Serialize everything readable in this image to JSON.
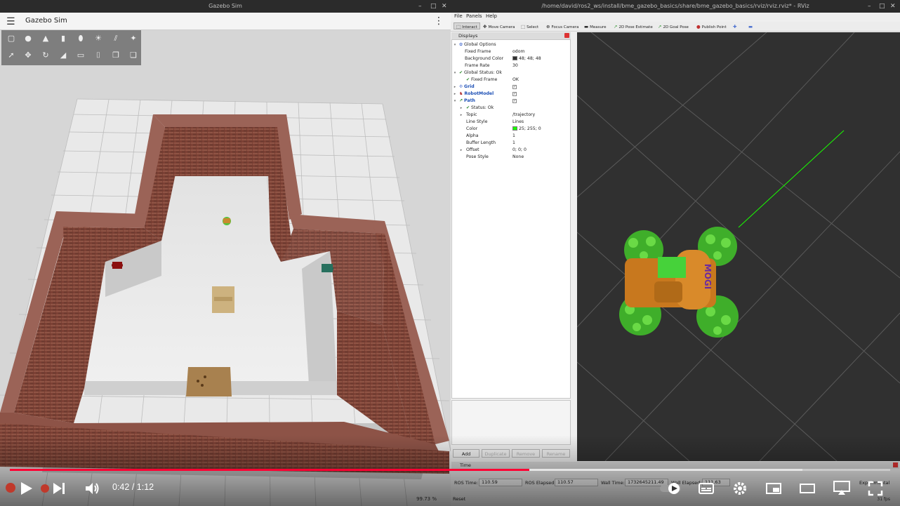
{
  "gazebo": {
    "window_title": "Gazebo Sim",
    "app_title": "Gazebo Sim",
    "fps": "99.73 %",
    "colors": {
      "wall_brick": "#8a4a3c",
      "floor": "#e6e6e6",
      "grid": "#bdbdbd"
    }
  },
  "rviz": {
    "window_title": "/home/david/ros2_ws/install/bme_gazebo_basics/share/bme_gazebo_basics/rviz/rviz.rviz* - RViz",
    "menu": {
      "file": "File",
      "panels": "Panels",
      "help": "Help"
    },
    "toolbar": {
      "interact": "Interact",
      "move_camera": "Move Camera",
      "select": "Select",
      "focus_camera": "Focus Camera",
      "measure": "Measure",
      "pose_estimate": "2D Pose Estimate",
      "goal_pose": "2D Goal Pose",
      "publish_point": "Publish Point"
    },
    "displays": {
      "title": "Displays",
      "global_options": "Global Options",
      "fixed_frame_label": "Fixed Frame",
      "fixed_frame_value": "odom",
      "background_color_label": "Background Color",
      "background_color_value": "48; 48; 48",
      "background_color_hex": "#303030",
      "frame_rate_label": "Frame Rate",
      "frame_rate_value": "30",
      "global_status": "Global Status: Ok",
      "fixed_frame_status_label": "Fixed Frame",
      "fixed_frame_status_value": "OK",
      "grid": "Grid",
      "robot_model": "RobotModel",
      "path": "Path",
      "status_ok": "Status: Ok",
      "topic_label": "Topic",
      "topic_value": "/trajectory",
      "line_style_label": "Line Style",
      "line_style_value": "Lines",
      "color_label": "Color",
      "color_value": "25; 255; 0",
      "color_hex": "#19ff00",
      "alpha_label": "Alpha",
      "alpha_value": "1",
      "buffer_length_label": "Buffer Length",
      "buffer_length_value": "1",
      "offset_label": "Offset",
      "offset_value": "0; 0; 0",
      "pose_style_label": "Pose Style",
      "pose_style_value": "None",
      "add_button": "Add",
      "duplicate_button": "Duplicate",
      "remove_button": "Remove",
      "rename_button": "Rename"
    },
    "robot_label": "MOGI",
    "time": {
      "title": "Time",
      "ros_time_label": "ROS Time:",
      "ros_time_value": "110.59",
      "ros_elapsed_label": "ROS Elapsed:",
      "ros_elapsed_value": "110.57",
      "wall_time_label": "Wall Time:",
      "wall_time_value": "1732645211.49",
      "wall_elapsed_label": "Wall Elapsed:",
      "wall_elapsed_value": "111.63",
      "experimental_label": "Experimental",
      "reset_button": "Reset",
      "fps": "31 fps"
    }
  },
  "player": {
    "current_time": "0:42",
    "duration": "1:12",
    "time_separator": " / ",
    "played_fraction": 0.59,
    "buffered_fraction": 0.9,
    "colors": {
      "played": "#ff0033"
    }
  }
}
